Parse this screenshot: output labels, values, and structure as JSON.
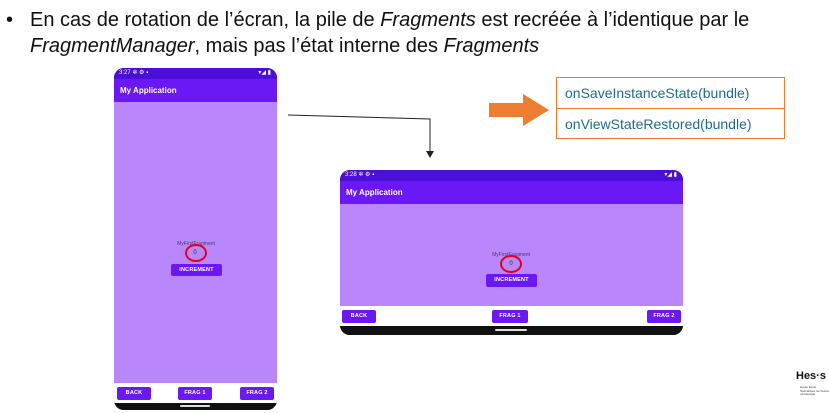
{
  "bullet": {
    "dot": "•",
    "parts": [
      {
        "text": "En cas de rotation de l’écran, la pile de ",
        "italic": false
      },
      {
        "text": "Fragments",
        "italic": true
      },
      {
        "text": " est recréée à l’identique par le ",
        "italic": false
      },
      {
        "text": "FragmentManager",
        "italic": true
      },
      {
        "text": ", mais pas l’état interne des ",
        "italic": false
      },
      {
        "text": "Fragments",
        "italic": true
      }
    ]
  },
  "portrait": {
    "status_time": "3:27 ✲ ⚙ ▪",
    "status_icons": "▾◢ ▮",
    "app_title": "My Application",
    "fragment_label": "MyFirstFragment",
    "counter": "0",
    "increment_label": "INCREMENT",
    "back_label": "BACK",
    "frag1_label": "FRAG 1",
    "frag2_label": "FRAG 2"
  },
  "landscape": {
    "status_time": "3:28 ✲ ⚙ ▪",
    "status_icons": "▾◢ ▮",
    "app_title": "My Application",
    "fragment_label": "MyFirstFragment",
    "counter": "0",
    "increment_label": "INCREMENT",
    "back_label": "BACK",
    "frag1_label": "FRAG 1",
    "frag2_label": "FRAG 2"
  },
  "callout": {
    "method1": "onSaveInstanceState(bundle)",
    "method2": "onViewStateRestored(bundle)"
  },
  "logo": {
    "text": "Hes·s",
    "sub": "Haute Ecole Spécialisée de Suisse occidentale"
  },
  "colors": {
    "primary": "#6a18f5",
    "status_bar": "#4b0fd9",
    "body": "#b986fb",
    "highlight_ring": "#e0001b",
    "arrow": "#ed7d31",
    "callout_text": "#1f6c8c"
  }
}
